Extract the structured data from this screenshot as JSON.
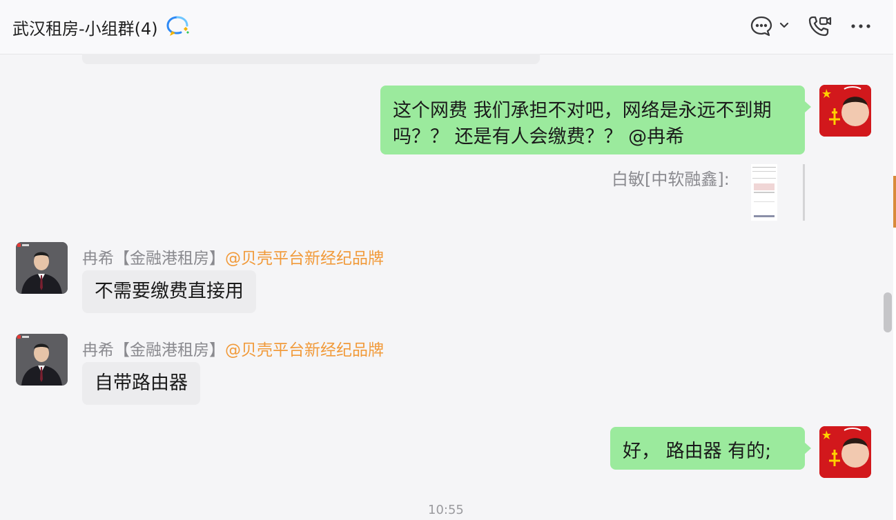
{
  "header": {
    "title": "武汉租房-小组群(4)"
  },
  "messages": {
    "m1": {
      "text_line1": "这个网费 我们承担不对吧，网络是永远不到期",
      "text_line2": "吗？？ 还是有人会缴费？？ @冉希"
    },
    "quote": {
      "text": "白敏[中软融鑫]:"
    },
    "m2": {
      "sender": "冉希【金融港租房】",
      "mention": "@贝壳平台新经纪品牌",
      "text": "不需要缴费直接用"
    },
    "m3": {
      "sender": "冉希【金融港租房】",
      "mention": "@贝壳平台新经纪品牌",
      "text": "自带路由器"
    },
    "m4": {
      "text": "好， 路由器 有的;"
    }
  },
  "timestamp": "10:55",
  "colors": {
    "outgoing_bubble": "#9bea9d",
    "incoming_bubble": "#ececee",
    "mention": "#f19a3a"
  }
}
